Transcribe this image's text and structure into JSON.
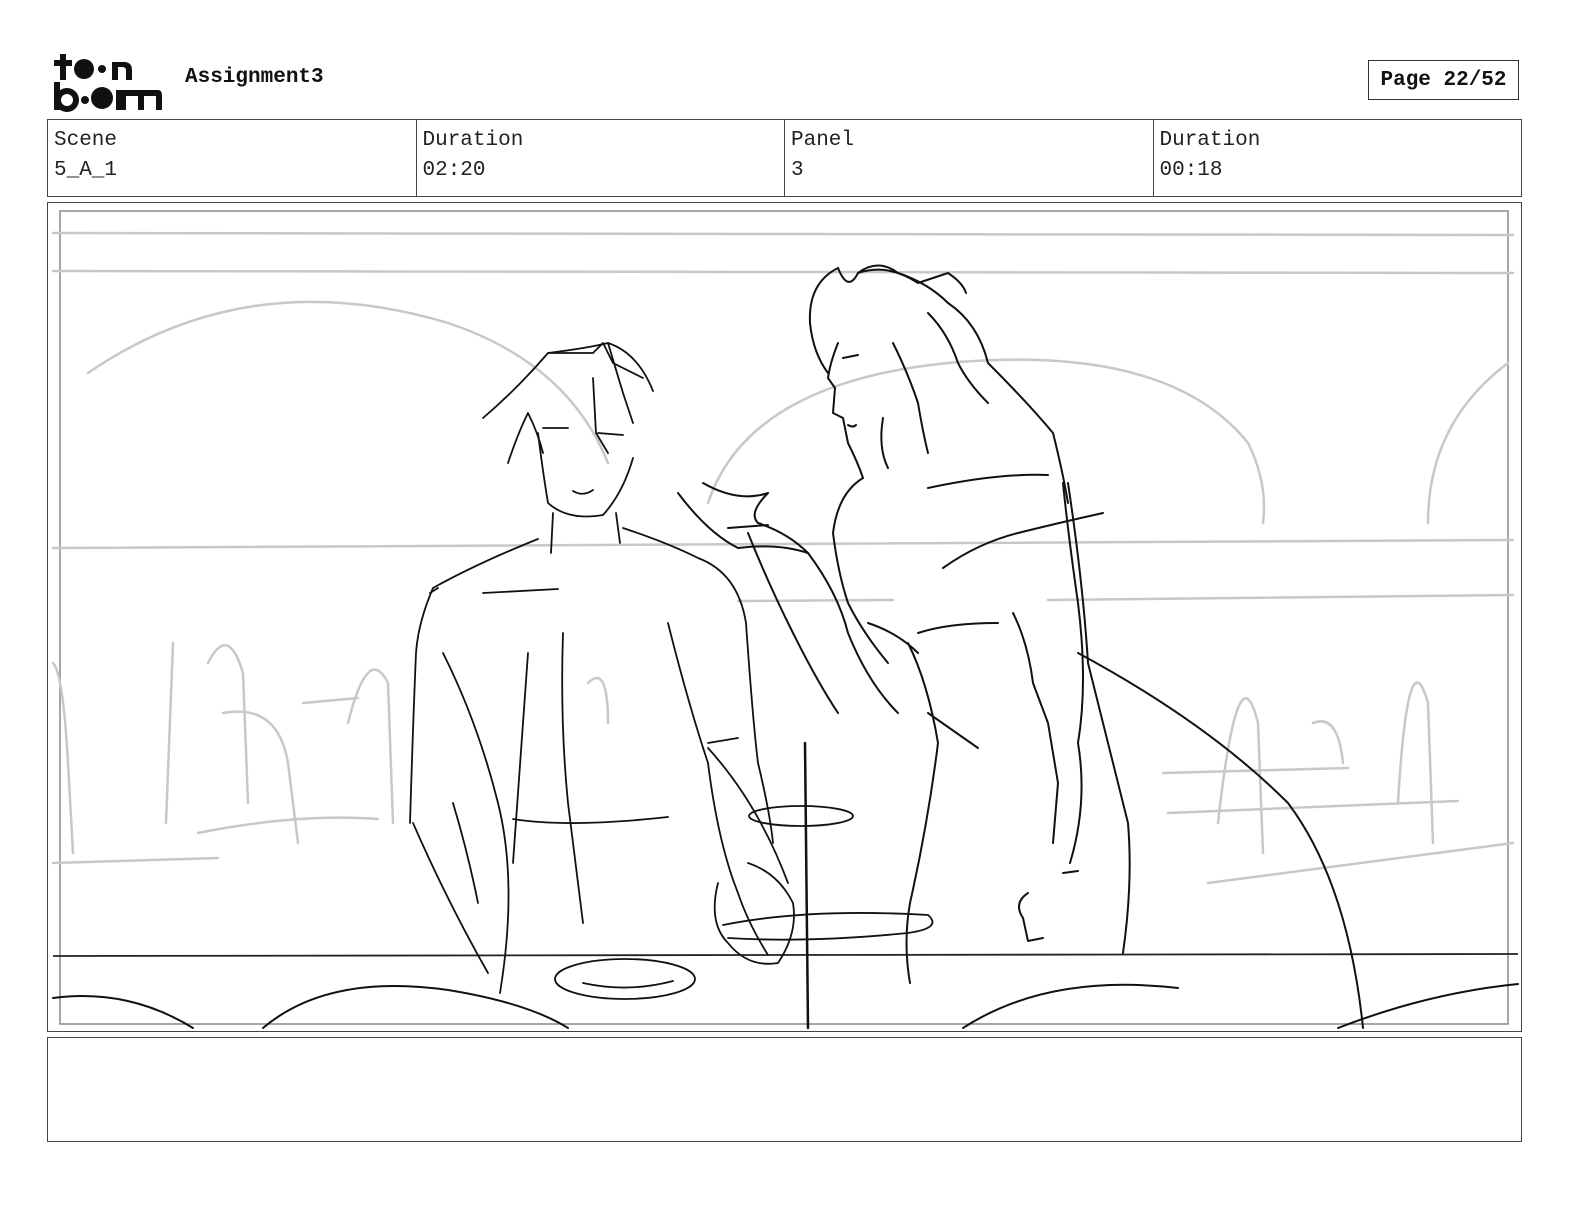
{
  "logo": {
    "line1": "toon",
    "line2": "boom"
  },
  "header": {
    "project_title": "Assignment3",
    "page_label": "Page 22/52"
  },
  "info": {
    "scene_label": "Scene",
    "scene_value": "5_A_1",
    "duration_label": "Duration",
    "duration_value": "02:20",
    "panel_label": "Panel",
    "panel_value": "3",
    "panel_duration_label": "Duration",
    "panel_duration_value": "00:18"
  },
  "notes": {
    "text": ""
  },
  "colors": {
    "ink": "#111111",
    "background_sketch": "#c8c8c8",
    "frame": "#444444"
  }
}
